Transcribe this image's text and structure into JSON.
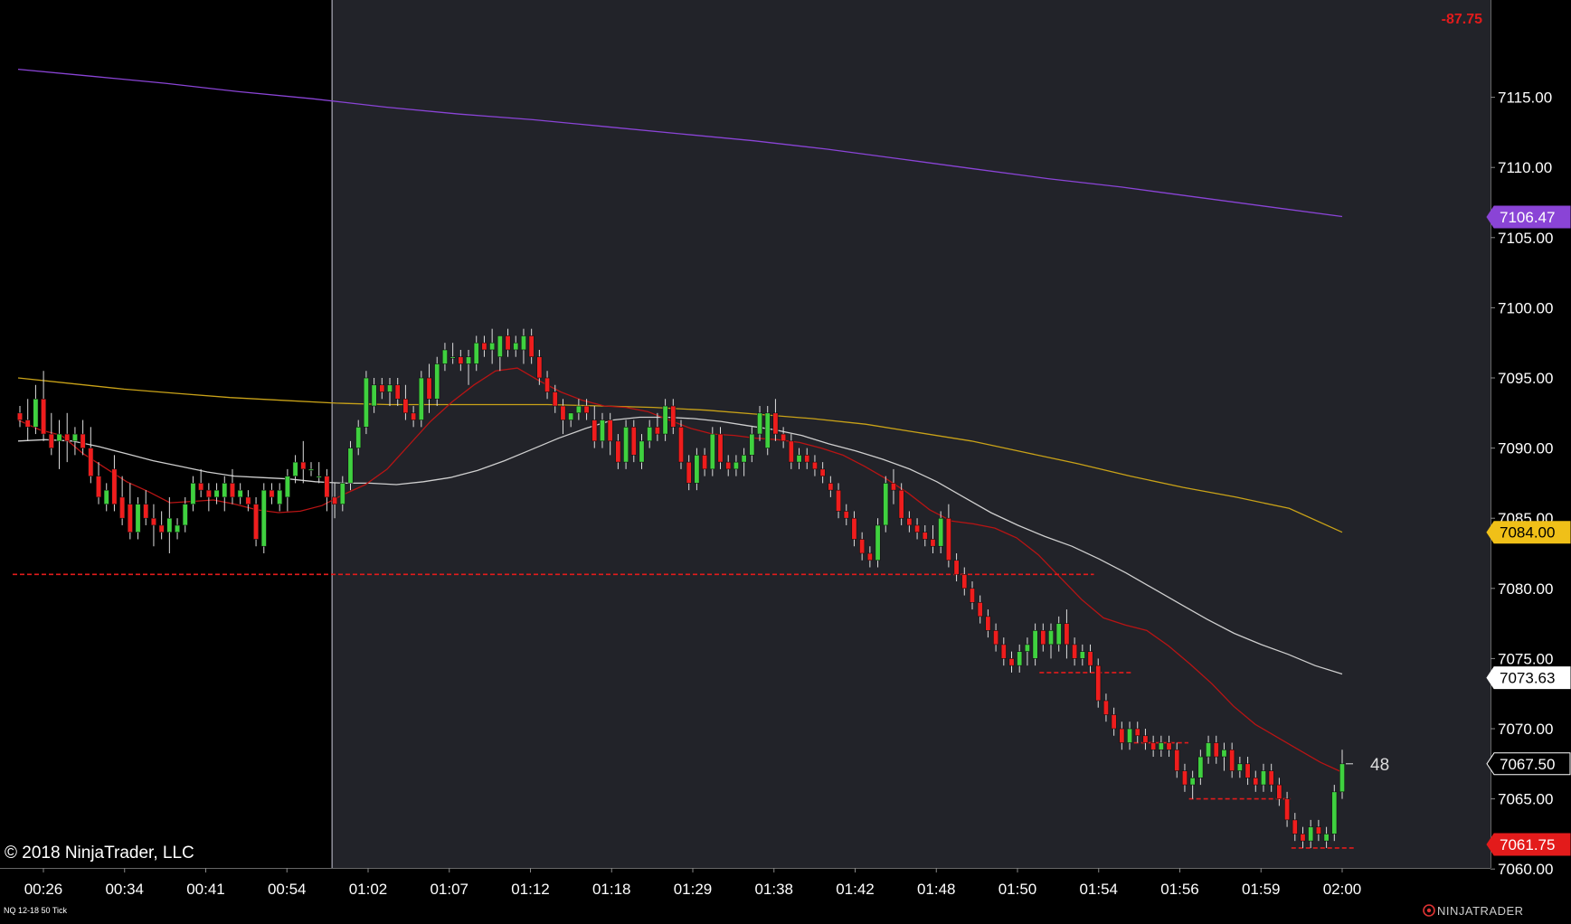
{
  "copyright": "© 2018 NinjaTrader, LLC",
  "instrument_label": "NQ 12-18 50 Tick",
  "brand": "NINJATRADER",
  "pnl_text": "-87.75",
  "tick_counter": "48",
  "colors": {
    "background_history": "#000000",
    "background_session": "#222329",
    "up_candle": "#3fd13f",
    "down_candle": "#ef1d1d",
    "wick": "#dddddd",
    "ema_fast": "#b81414",
    "ema_white": "#cfcfcf",
    "ema_gold": "#c9a218",
    "ema_purple": "#8a44d6",
    "level_line": "#e31b1b",
    "axis_text": "#ffffff"
  },
  "chart_data": {
    "type": "candlestick",
    "ylim": [
      7058.5,
      7119.5
    ],
    "yticks": [
      "7115.00",
      "7110.00",
      "7105.00",
      "7100.00",
      "7095.00",
      "7090.00",
      "7085.00",
      "7080.00",
      "7075.00",
      "7070.00",
      "7065.00",
      "7060.00"
    ],
    "xtick_labels": [
      "00:26",
      "00:34",
      "00:41",
      "00:54",
      "01:02",
      "01:07",
      "01:12",
      "01:18",
      "01:29",
      "01:38",
      "01:42",
      "01:48",
      "01:50",
      "01:54",
      "01:56",
      "01:59",
      "02:00"
    ],
    "session_start_label_index": 3.55,
    "price_markers": [
      {
        "label": "7106.47",
        "value": 7106.47,
        "bg": "#8a44d6",
        "fg": "#ffffff"
      },
      {
        "label": "7084.00",
        "value": 7084.0,
        "bg": "#f0c018",
        "fg": "#000000"
      },
      {
        "label": "7073.63",
        "value": 7073.63,
        "bg": "#ffffff",
        "fg": "#000000"
      },
      {
        "label": "7067.50",
        "value": 7067.5,
        "bg": "#000000",
        "fg": "#ffffff"
      },
      {
        "label": "7061.75",
        "value": 7061.75,
        "bg": "#e31b1b",
        "fg": "#ffffff"
      }
    ],
    "candles": [
      [
        7092.5,
        7093.0,
        7091.5,
        7092.0
      ],
      [
        7092.0,
        7093.5,
        7090.5,
        7091.5
      ],
      [
        7091.5,
        7094.5,
        7091.0,
        7093.5
      ],
      [
        7093.5,
        7095.5,
        7090.5,
        7091.0
      ],
      [
        7091.0,
        7092.5,
        7089.5,
        7090.0
      ],
      [
        7090.5,
        7092.0,
        7088.5,
        7091.0
      ],
      [
        7091.0,
        7092.5,
        7089.0,
        7090.5
      ],
      [
        7090.5,
        7091.5,
        7089.5,
        7091.0
      ],
      [
        7091.0,
        7092.0,
        7089.5,
        7090.0
      ],
      [
        7090.0,
        7091.5,
        7087.5,
        7088.0
      ],
      [
        7088.0,
        7089.0,
        7086.0,
        7086.5
      ],
      [
        7086.0,
        7087.5,
        7085.5,
        7087.0
      ],
      [
        7088.5,
        7089.5,
        7085.5,
        7086.0
      ],
      [
        7086.5,
        7088.0,
        7084.5,
        7085.0
      ],
      [
        7086.0,
        7087.5,
        7083.5,
        7084.0
      ],
      [
        7084.0,
        7086.5,
        7083.5,
        7086.0
      ],
      [
        7086.0,
        7087.0,
        7084.5,
        7085.0
      ],
      [
        7085.0,
        7086.0,
        7083.0,
        7084.5
      ],
      [
        7084.5,
        7085.5,
        7083.5,
        7084.0
      ],
      [
        7084.0,
        7086.5,
        7082.5,
        7085.0
      ],
      [
        7084.0,
        7085.0,
        7083.5,
        7084.5
      ],
      [
        7084.5,
        7086.5,
        7084.0,
        7086.0
      ],
      [
        7086.0,
        7088.0,
        7085.5,
        7087.5
      ],
      [
        7087.5,
        7088.5,
        7086.5,
        7087.0
      ],
      [
        7087.0,
        7087.5,
        7085.5,
        7086.5
      ],
      [
        7086.5,
        7087.5,
        7086.0,
        7087.0
      ],
      [
        7086.5,
        7088.0,
        7085.5,
        7087.5
      ],
      [
        7087.5,
        7088.5,
        7086.0,
        7086.5
      ],
      [
        7086.5,
        7087.5,
        7086.0,
        7087.0
      ],
      [
        7086.5,
        7087.0,
        7085.5,
        7086.0
      ],
      [
        7086.0,
        7086.5,
        7083.0,
        7083.5
      ],
      [
        7083.0,
        7087.5,
        7082.5,
        7087.0
      ],
      [
        7087.0,
        7087.5,
        7086.0,
        7086.5
      ],
      [
        7086.0,
        7087.5,
        7085.5,
        7087.0
      ],
      [
        7086.5,
        7088.5,
        7085.5,
        7088.0
      ],
      [
        7088.0,
        7089.5,
        7087.5,
        7089.0
      ],
      [
        7089.0,
        7090.5,
        7087.5,
        7088.5
      ],
      [
        7088.5,
        7089.0,
        7088.0,
        7088.5
      ],
      [
        7088.0,
        7089.0,
        7087.5,
        7088.0
      ],
      [
        7088.0,
        7088.5,
        7085.5,
        7086.5
      ],
      [
        7086.5,
        7087.5,
        7085.0,
        7086.0
      ],
      [
        7086.0,
        7088.0,
        7085.5,
        7087.5
      ],
      [
        7087.5,
        7090.5,
        7087.0,
        7090.0
      ],
      [
        7090.0,
        7092.0,
        7089.5,
        7091.5
      ],
      [
        7091.5,
        7095.5,
        7091.0,
        7095.0
      ],
      [
        7093.0,
        7095.0,
        7092.5,
        7094.5
      ],
      [
        7094.5,
        7095.0,
        7093.5,
        7094.0
      ],
      [
        7094.0,
        7095.0,
        7093.0,
        7094.5
      ],
      [
        7094.5,
        7095.0,
        7093.0,
        7093.5
      ],
      [
        7093.5,
        7094.5,
        7092.0,
        7092.5
      ],
      [
        7092.5,
        7093.0,
        7091.5,
        7092.0
      ],
      [
        7092.0,
        7095.5,
        7091.5,
        7095.0
      ],
      [
        7095.0,
        7096.0,
        7092.5,
        7093.5
      ],
      [
        7093.5,
        7096.5,
        7093.0,
        7096.0
      ],
      [
        7096.0,
        7097.5,
        7095.5,
        7097.0
      ],
      [
        7096.5,
        7097.5,
        7096.0,
        7096.5
      ],
      [
        7096.5,
        7097.0,
        7095.5,
        7096.0
      ],
      [
        7096.0,
        7097.0,
        7094.5,
        7096.5
      ],
      [
        7096.0,
        7098.0,
        7095.5,
        7097.5
      ],
      [
        7097.5,
        7098.0,
        7096.5,
        7097.0
      ],
      [
        7097.0,
        7098.5,
        7096.0,
        7097.5
      ],
      [
        7096.5,
        7098.0,
        7095.5,
        7098.0
      ],
      [
        7098.0,
        7098.5,
        7096.5,
        7097.0
      ],
      [
        7097.0,
        7098.0,
        7096.5,
        7097.5
      ],
      [
        7097.0,
        7098.5,
        7096.0,
        7098.0
      ],
      [
        7098.0,
        7098.5,
        7096.0,
        7096.5
      ],
      [
        7096.5,
        7097.0,
        7094.5,
        7095.0
      ],
      [
        7095.0,
        7095.5,
        7093.5,
        7094.0
      ],
      [
        7094.0,
        7094.5,
        7092.5,
        7093.0
      ],
      [
        7093.0,
        7093.5,
        7091.0,
        7092.0
      ],
      [
        7092.0,
        7092.5,
        7091.5,
        7092.5
      ],
      [
        7092.5,
        7093.5,
        7092.0,
        7093.0
      ],
      [
        7093.0,
        7093.5,
        7092.0,
        7092.5
      ],
      [
        7092.0,
        7093.0,
        7090.0,
        7090.5
      ],
      [
        7090.5,
        7092.5,
        7090.0,
        7092.0
      ],
      [
        7092.0,
        7092.5,
        7089.5,
        7090.5
      ],
      [
        7090.5,
        7091.0,
        7088.5,
        7089.0
      ],
      [
        7089.0,
        7092.0,
        7088.5,
        7091.5
      ],
      [
        7091.5,
        7092.0,
        7089.0,
        7089.5
      ],
      [
        7089.0,
        7091.0,
        7088.5,
        7090.5
      ],
      [
        7090.5,
        7092.0,
        7090.0,
        7091.5
      ],
      [
        7091.5,
        7092.5,
        7090.5,
        7091.0
      ],
      [
        7091.0,
        7093.5,
        7090.5,
        7093.0
      ],
      [
        7093.0,
        7093.5,
        7091.0,
        7091.5
      ],
      [
        7091.5,
        7092.0,
        7088.5,
        7089.0
      ],
      [
        7089.0,
        7089.5,
        7087.0,
        7087.5
      ],
      [
        7087.5,
        7090.0,
        7087.0,
        7089.5
      ],
      [
        7089.5,
        7090.0,
        7088.0,
        7088.5
      ],
      [
        7088.5,
        7091.5,
        7088.0,
        7091.0
      ],
      [
        7091.0,
        7091.5,
        7088.5,
        7089.0
      ],
      [
        7089.0,
        7089.5,
        7088.0,
        7088.5
      ],
      [
        7088.5,
        7089.5,
        7088.0,
        7089.0
      ],
      [
        7089.0,
        7090.0,
        7088.0,
        7089.5
      ],
      [
        7089.5,
        7091.5,
        7089.0,
        7091.0
      ],
      [
        7091.0,
        7093.0,
        7090.5,
        7092.5
      ],
      [
        7090.0,
        7093.0,
        7089.5,
        7092.5
      ],
      [
        7092.5,
        7093.5,
        7090.5,
        7091.0
      ],
      [
        7091.0,
        7091.5,
        7090.0,
        7090.5
      ],
      [
        7090.5,
        7091.0,
        7088.5,
        7089.0
      ],
      [
        7089.0,
        7090.0,
        7088.5,
        7089.5
      ],
      [
        7089.5,
        7090.0,
        7088.5,
        7089.0
      ],
      [
        7089.0,
        7089.5,
        7088.0,
        7088.5
      ],
      [
        7088.5,
        7089.0,
        7087.5,
        7088.0
      ],
      [
        7087.5,
        7088.0,
        7086.5,
        7087.0
      ],
      [
        7087.0,
        7087.5,
        7085.0,
        7085.5
      ],
      [
        7085.5,
        7086.0,
        7084.5,
        7085.0
      ],
      [
        7085.0,
        7085.5,
        7083.0,
        7083.5
      ],
      [
        7083.5,
        7084.0,
        7082.0,
        7082.5
      ],
      [
        7082.5,
        7083.0,
        7081.5,
        7082.0
      ],
      [
        7082.0,
        7085.0,
        7081.5,
        7084.5
      ],
      [
        7084.5,
        7088.0,
        7084.0,
        7087.5
      ],
      [
        7087.5,
        7088.5,
        7086.0,
        7087.0
      ],
      [
        7087.0,
        7087.5,
        7084.5,
        7085.0
      ],
      [
        7085.0,
        7085.5,
        7084.0,
        7084.5
      ],
      [
        7084.5,
        7085.0,
        7083.5,
        7084.0
      ],
      [
        7084.0,
        7084.5,
        7083.0,
        7083.5
      ],
      [
        7083.5,
        7084.5,
        7082.5,
        7083.0
      ],
      [
        7083.0,
        7085.5,
        7082.5,
        7085.0
      ],
      [
        7085.0,
        7086.0,
        7081.5,
        7082.0
      ],
      [
        7082.0,
        7082.5,
        7080.5,
        7081.0
      ],
      [
        7081.0,
        7081.5,
        7079.5,
        7080.0
      ],
      [
        7080.0,
        7080.5,
        7078.5,
        7079.0
      ],
      [
        7079.0,
        7079.5,
        7077.5,
        7078.0
      ],
      [
        7078.0,
        7078.5,
        7076.5,
        7077.0
      ],
      [
        7077.0,
        7077.5,
        7075.5,
        7076.0
      ],
      [
        7076.0,
        7076.5,
        7074.5,
        7075.0
      ],
      [
        7075.0,
        7075.5,
        7074.0,
        7074.5
      ],
      [
        7074.5,
        7076.0,
        7074.0,
        7075.5
      ],
      [
        7075.5,
        7076.5,
        7074.5,
        7076.0
      ],
      [
        7075.0,
        7077.5,
        7074.5,
        7077.0
      ],
      [
        7077.0,
        7077.5,
        7075.5,
        7076.0
      ],
      [
        7076.0,
        7077.5,
        7075.0,
        7077.0
      ],
      [
        7076.0,
        7078.0,
        7075.5,
        7077.5
      ],
      [
        7077.5,
        7078.5,
        7075.0,
        7076.0
      ],
      [
        7076.0,
        7076.5,
        7074.5,
        7075.0
      ],
      [
        7075.0,
        7076.0,
        7074.5,
        7075.5
      ],
      [
        7075.5,
        7076.0,
        7074.0,
        7074.5
      ],
      [
        7074.5,
        7075.0,
        7071.5,
        7072.0
      ],
      [
        7072.0,
        7072.5,
        7070.5,
        7071.0
      ],
      [
        7071.0,
        7071.5,
        7069.5,
        7070.0
      ],
      [
        7070.0,
        7070.5,
        7068.5,
        7069.0
      ],
      [
        7069.0,
        7070.5,
        7068.5,
        7070.0
      ],
      [
        7070.0,
        7070.5,
        7069.0,
        7069.5
      ],
      [
        7069.5,
        7070.0,
        7068.5,
        7069.0
      ],
      [
        7069.0,
        7069.5,
        7068.0,
        7068.5
      ],
      [
        7068.5,
        7069.5,
        7068.0,
        7069.0
      ],
      [
        7069.0,
        7069.5,
        7068.0,
        7068.5
      ],
      [
        7068.5,
        7069.0,
        7066.5,
        7067.0
      ],
      [
        7067.0,
        7067.5,
        7065.5,
        7066.0
      ],
      [
        7066.0,
        7067.0,
        7065.0,
        7066.5
      ],
      [
        7066.5,
        7068.5,
        7066.0,
        7068.0
      ],
      [
        7068.0,
        7069.5,
        7067.5,
        7069.0
      ],
      [
        7069.0,
        7069.5,
        7067.5,
        7068.0
      ],
      [
        7068.0,
        7069.0,
        7067.0,
        7068.5
      ],
      [
        7068.5,
        7069.0,
        7066.5,
        7067.0
      ],
      [
        7067.0,
        7068.0,
        7066.5,
        7067.5
      ],
      [
        7067.5,
        7068.0,
        7066.0,
        7066.5
      ],
      [
        7066.5,
        7067.0,
        7065.5,
        7066.0
      ],
      [
        7066.0,
        7067.5,
        7065.5,
        7067.0
      ],
      [
        7067.0,
        7067.5,
        7065.5,
        7066.0
      ],
      [
        7066.0,
        7066.5,
        7064.5,
        7065.0
      ],
      [
        7065.0,
        7065.5,
        7063.0,
        7063.5
      ],
      [
        7063.5,
        7064.0,
        7062.0,
        7062.5
      ],
      [
        7062.5,
        7063.0,
        7061.5,
        7062.0
      ],
      [
        7062.0,
        7063.5,
        7061.5,
        7063.0
      ],
      [
        7063.0,
        7063.5,
        7062.0,
        7062.5
      ],
      [
        7062.0,
        7063.0,
        7061.5,
        7062.5
      ],
      [
        7062.5,
        7066.0,
        7062.0,
        7065.5
      ],
      [
        7065.5,
        7068.5,
        7065.0,
        7067.5
      ]
    ],
    "ema_fast": [
      7092.0,
      7091.3,
      7090.9,
      7089.6,
      7088.6,
      7087.6,
      7086.9,
      7086.1,
      7086.2,
      7086.3,
      7086.0,
      7085.6,
      7085.4,
      7085.5,
      7085.9,
      7086.7,
      7087.4,
      7088.5,
      7090.2,
      7091.9,
      7093.3,
      7094.5,
      7095.5,
      7095.7,
      7094.8,
      7094.0,
      7093.4,
      7093.0,
      7092.9,
      7092.6,
      7092.0,
      7091.4,
      7091.0,
      7090.9,
      7090.7,
      7090.6,
      7090.4,
      7090.0,
      7089.5,
      7088.7,
      7087.8,
      7086.8,
      7085.6,
      7084.8,
      7084.6,
      7084.3,
      7083.6,
      7082.4,
      7080.8,
      7079.2,
      7077.9,
      7077.4,
      7077.0,
      7075.9,
      7074.6,
      7073.2,
      7071.6,
      7070.3,
      7069.4,
      7068.5,
      7067.6,
      7066.9
    ],
    "ema_white": [
      7090.5,
      7090.6,
      7090.5,
      7090.1,
      7089.6,
      7089.1,
      7088.7,
      7088.3,
      7088.0,
      7087.9,
      7087.8,
      7087.6,
      7087.5,
      7087.5,
      7087.4,
      7087.6,
      7087.9,
      7088.4,
      7089.1,
      7089.9,
      7090.7,
      7091.4,
      7092.0,
      7092.2,
      7092.2,
      7092.1,
      7091.9,
      7091.6,
      7091.3,
      7090.9,
      7090.3,
      7089.8,
      7089.2,
      7088.5,
      7087.6,
      7086.5,
      7085.4,
      7084.5,
      7083.7,
      7083.0,
      7082.1,
      7081.1,
      7080.0,
      7078.9,
      7077.8,
      7076.8,
      7076.0,
      7075.3,
      7074.5,
      7073.9
    ],
    "ema_gold": [
      7095.0,
      7094.6,
      7094.2,
      7093.9,
      7093.6,
      7093.4,
      7093.2,
      7093.1,
      7093.1,
      7093.1,
      7093.1,
      7093.0,
      7092.9,
      7092.7,
      7092.4,
      7092.1,
      7091.7,
      7091.1,
      7090.5,
      7089.7,
      7088.9,
      7088.0,
      7087.2,
      7086.5,
      7085.7,
      7084.0
    ],
    "ema_purple": [
      7117.0,
      7116.5,
      7116.0,
      7115.4,
      7114.9,
      7114.3,
      7113.8,
      7113.4,
      7112.9,
      7112.4,
      7111.9,
      7111.3,
      7110.6,
      7109.9,
      7109.2,
      7108.6,
      7107.9,
      7107.2,
      7106.5
    ],
    "level_lines": [
      {
        "value": 7081.0,
        "from": 0,
        "to": 136
      },
      {
        "value": 7074.0,
        "from": 130,
        "to": 141
      },
      {
        "value": 7069.0,
        "from": 142,
        "to": 148
      },
      {
        "value": 7065.0,
        "from": 149,
        "to": 161
      },
      {
        "value": 7061.5,
        "from": 162,
        "to": 169
      }
    ]
  }
}
